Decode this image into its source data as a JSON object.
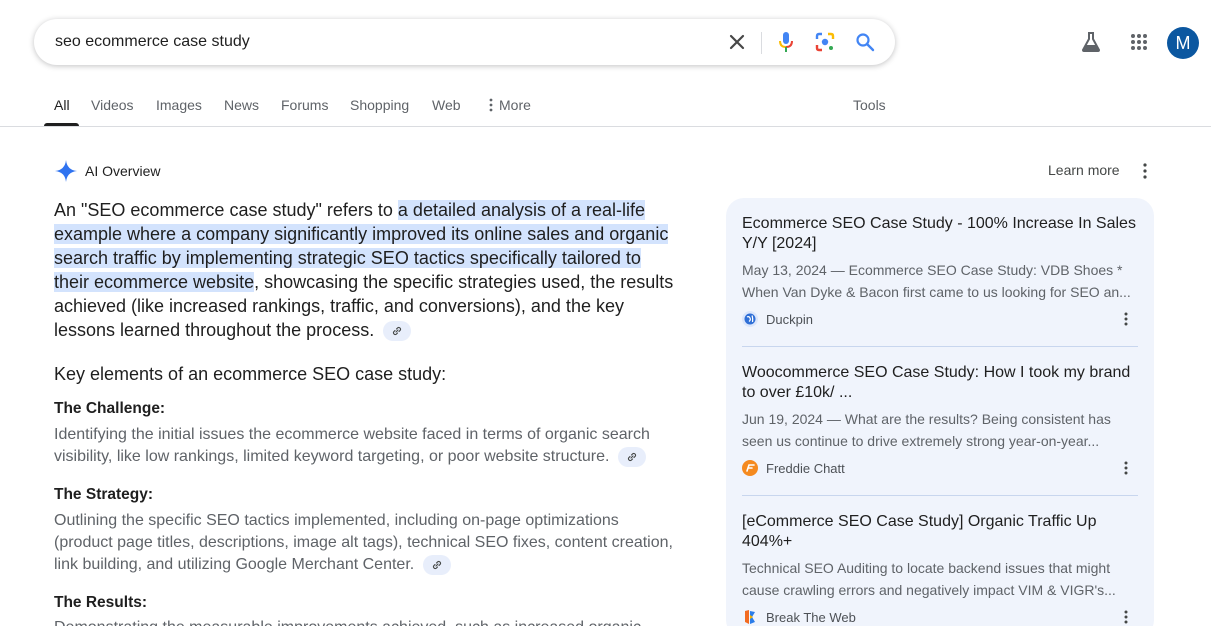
{
  "search": {
    "query": "seo ecommerce case study",
    "icons": [
      "clear-icon",
      "microphone-icon",
      "google-lens-icon",
      "search-icon"
    ]
  },
  "header": {
    "labs_icon": "flask-icon",
    "apps_icon": "grid-icon",
    "avatar_letter": "M",
    "avatar_color": "#0b57a0"
  },
  "tabs": {
    "items": [
      {
        "label": "All",
        "active": true
      },
      {
        "label": "Videos"
      },
      {
        "label": "Images"
      },
      {
        "label": "News"
      },
      {
        "label": "Forums"
      },
      {
        "label": "Shopping"
      },
      {
        "label": "Web"
      },
      {
        "label": "More"
      }
    ],
    "tools": "Tools"
  },
  "ai_overview": {
    "title": "AI Overview",
    "learn_more": "Learn more",
    "intro_pre": "An \"SEO ecommerce case study\" refers to ",
    "intro_highlight": "a detailed analysis of a real-life example where a company significantly improved its online sales and organic search traffic by implementing strategic SEO tactics specifically tailored to their ecommerce website",
    "intro_post": ", showcasing the specific strategies used, the results achieved (like increased rankings, traffic, and conversions), and the key lessons learned throughout the process.",
    "key_heading": "Key elements of an ecommerce SEO case study:",
    "sections": [
      {
        "title": "The Challenge:",
        "body": "Identifying the initial issues the ecommerce website faced in terms of organic search visibility, like low rankings, limited keyword targeting, or poor website structure."
      },
      {
        "title": "The Strategy:",
        "body": "Outlining the specific SEO tactics implemented, including on-page optimizations (product page titles, descriptions, image alt tags), technical SEO fixes, content creation, link building, and utilizing Google Merchant Center."
      },
      {
        "title": "The Results:",
        "body": "Demonstrating the measurable improvements achieved, such as increased organic"
      }
    ],
    "highlight_color": "#d3e3fd"
  },
  "sources": [
    {
      "title": "Ecommerce SEO Case Study - 100% Increase In Sales Y/Y [2024]",
      "snippet_line1": "May 13, 2024 — Ecommerce SEO Case Study: VDB Shoes *",
      "snippet_line2": "When Van Dyke & Bacon first came to us looking for SEO an...",
      "site": "Duckpin",
      "favicon": "globe-icon"
    },
    {
      "title": "Woocommerce SEO Case Study: How I took my brand to over £10k/ ...",
      "snippet_line1": "Jun 19, 2024 — What are the results? Being consistent has",
      "snippet_line2": "seen us continue to drive extremely strong year-on-year...",
      "site": "Freddie Chatt",
      "favicon": "freddie-chatt-logo-icon"
    },
    {
      "title": "[eCommerce SEO Case Study] Organic Traffic Up 404%+",
      "snippet_line1": "Technical SEO Auditing to locate backend issues that might",
      "snippet_line2": "cause crawling errors and negatively impact VIM & VIGR's...",
      "site": "Break The Web",
      "favicon": "break-the-web-logo-icon"
    }
  ]
}
